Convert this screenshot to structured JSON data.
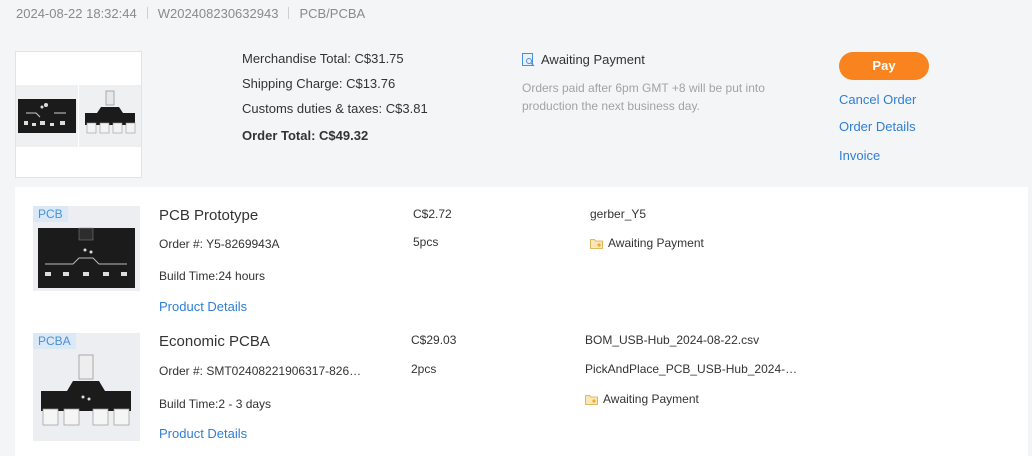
{
  "header": {
    "datetime": "2024-08-22 18:32:44",
    "order_number": "W202408230632943",
    "category": "PCB/PCBA"
  },
  "summary": {
    "merchandise_total": "Merchandise Total: C$31.75",
    "shipping_charge": "Shipping Charge: C$13.76",
    "customs": "Customs duties & taxes: C$3.81",
    "order_total": "Order Total: C$49.32"
  },
  "status": {
    "label": "Awaiting Payment",
    "note": "Orders paid after 6pm GMT +8 will be put into production the next business day."
  },
  "actions": {
    "pay": "Pay",
    "cancel": "Cancel Order",
    "details": "Order Details",
    "invoice": "Invoice"
  },
  "items": [
    {
      "badge": "PCB",
      "title": "PCB Prototype",
      "order": "Order #: Y5-8269943A",
      "build_time": "Build Time:24 hours",
      "details_link": "Product Details",
      "price": "C$2.72",
      "qty": "5pcs",
      "file": "gerber_Y5",
      "status": "Awaiting Payment"
    },
    {
      "badge": "PCBA",
      "title": "Economic PCBA",
      "order": "Order #: SMT02408221906317-826…",
      "build_time": "Build Time:2 - 3 days",
      "details_link": "Product Details",
      "price": "C$29.03",
      "qty": "2pcs",
      "file": "BOM_USB-Hub_2024-08-22.csv",
      "file2": "PickAndPlace_PCB_USB-Hub_2024-…",
      "status": "Awaiting Payment"
    }
  ],
  "colors": {
    "accent_orange": "#f8831f",
    "link_blue": "#2f7fd3",
    "background": "#f4f5f7"
  },
  "icons": {
    "status": "payment-status-icon",
    "folder": "folder-icon"
  }
}
